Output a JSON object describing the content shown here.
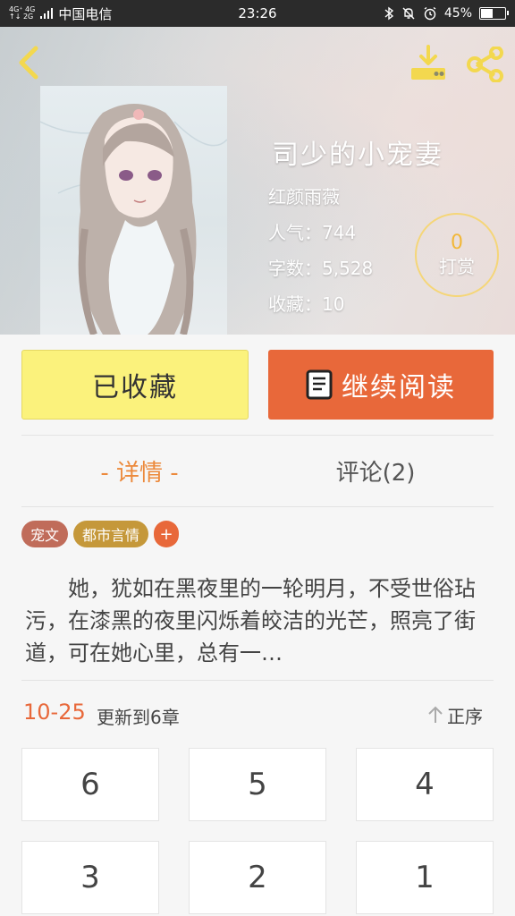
{
  "status_bar": {
    "net_top": "4G⁺ 4G",
    "net_bottom": "↑↓ 2G",
    "carrier": "中国电信",
    "time": "23:26",
    "battery": "45%",
    "battery_level": 0.45
  },
  "book": {
    "title": "司少的小宠妻",
    "author": "红颜雨薇",
    "popularity": "人气：744",
    "word_count": "字数：5,528",
    "favorites": "收藏：10"
  },
  "reward": {
    "count": "0",
    "label": "打赏"
  },
  "actions": {
    "collected_label": "已收藏",
    "read_label": "继续阅读"
  },
  "tabs": {
    "details": "- 详情 -",
    "comments": "评论(2)"
  },
  "tags": [
    {
      "label": "宠文",
      "color": "#c06c5a"
    },
    {
      "label": "都市言情",
      "color": "#c5983a"
    }
  ],
  "tag_add_label": "+",
  "synopsis": "她，犹如在黑夜里的一轮明月，不受世俗玷污，在漆黑的夜里闪烁着皎洁的光芒，照亮了街道，可在她心里，总有一…",
  "update": {
    "date": "10-25",
    "text": "更新到6章"
  },
  "sort": {
    "label": "正序"
  },
  "chapters": [
    "6",
    "5",
    "4",
    "3",
    "2",
    "1"
  ],
  "colors": {
    "accent_orange": "#e8683a",
    "accent_yellow": "#fbf27c",
    "icon_yellow": "#f3d84f"
  }
}
